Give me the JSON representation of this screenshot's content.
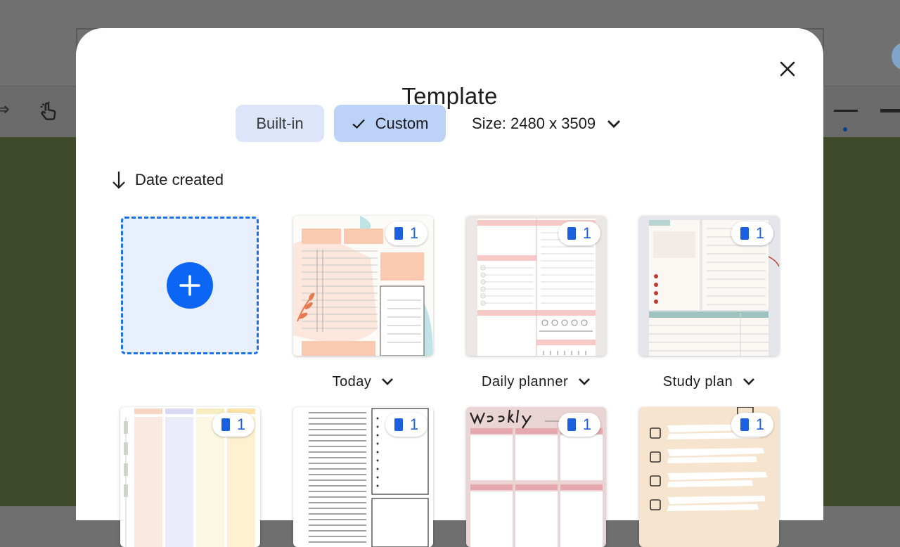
{
  "dialog": {
    "title": "Template",
    "close_icon": "close-icon"
  },
  "source_tabs": [
    {
      "label": "Built-in",
      "selected": false
    },
    {
      "label": "Custom",
      "selected": true
    }
  ],
  "size_selector": {
    "label": "Size: 2480 x 3509",
    "icon": "chevron-down-icon"
  },
  "sort": {
    "label": "Date created",
    "icon": "arrow-down-icon"
  },
  "add_tile": {
    "icon": "plus-icon"
  },
  "templates_row1": [
    {
      "name": "Today",
      "pages": "1"
    },
    {
      "name": "Daily planner",
      "pages": "1"
    },
    {
      "name": "Study plan",
      "pages": "1"
    }
  ],
  "templates_row2": [
    {
      "pages": "1"
    },
    {
      "pages": "1"
    },
    {
      "pages": "1"
    },
    {
      "pages": "1"
    }
  ],
  "colors": {
    "accent": "#0b66f5",
    "tab_selected": "#bcd3f7",
    "tab_unselected": "#dce6f8"
  }
}
